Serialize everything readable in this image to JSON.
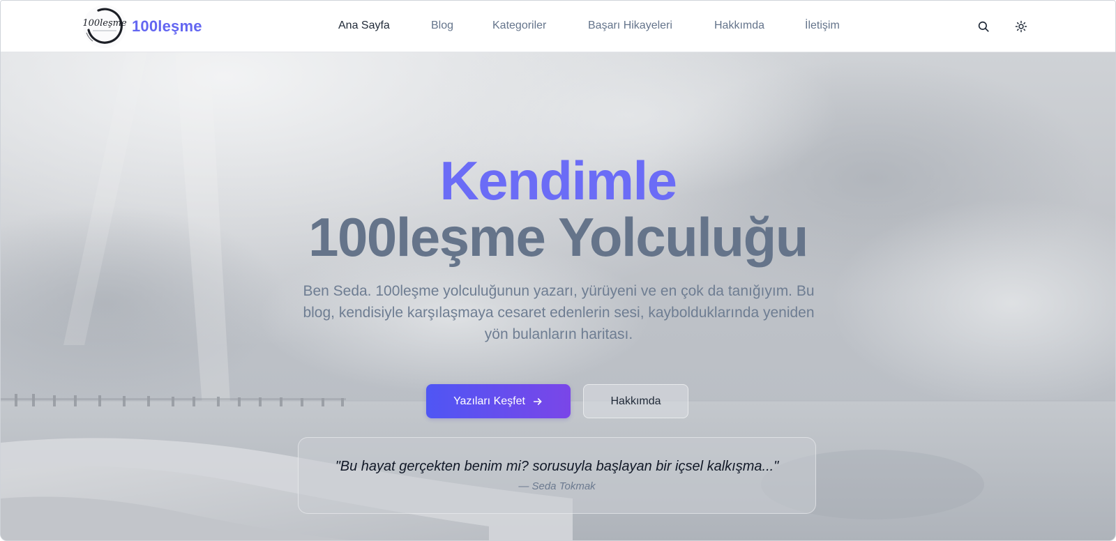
{
  "brand": {
    "name": "100leşme",
    "logo_text": "100leşme"
  },
  "nav": {
    "items": [
      {
        "label": "Ana Sayfa",
        "active": true
      },
      {
        "label": "Blog",
        "active": false
      },
      {
        "label": "Kategoriler",
        "active": false
      },
      {
        "label": "Başarı Hikayeleri",
        "active": false
      },
      {
        "label": "Hakkımda",
        "active": false
      },
      {
        "label": "İletişim",
        "active": false
      }
    ],
    "icons": [
      "search-icon",
      "sun-icon"
    ]
  },
  "hero": {
    "title_highlight": "Kendimle",
    "title_main": "100leşme Yolculuğu",
    "intro": "Ben Seda. 100leşme yolculuğunun yazarı, yürüyeni ve en çok da tanığıyım. Bu blog, kendisiyle karşılaşmaya cesaret edenlerin sesi, kaybolduklarında yeniden yön bulanların haritası.",
    "primary_button": "Yazıları Keşfet",
    "primary_button_icon": "arrow-right-icon",
    "secondary_button": "Hakkımda",
    "quote": "\"Bu hayat gerçekten benim mi? sorusuyla başlayan bir içsel kalkışma...\"",
    "quote_author": "— Seda Tokmak"
  },
  "colors": {
    "accent": "#6366f1",
    "gradient_start": "#4f56f4",
    "gradient_end": "#7a46e8",
    "nav_text": "#64748b",
    "nav_active": "#1f2937"
  }
}
